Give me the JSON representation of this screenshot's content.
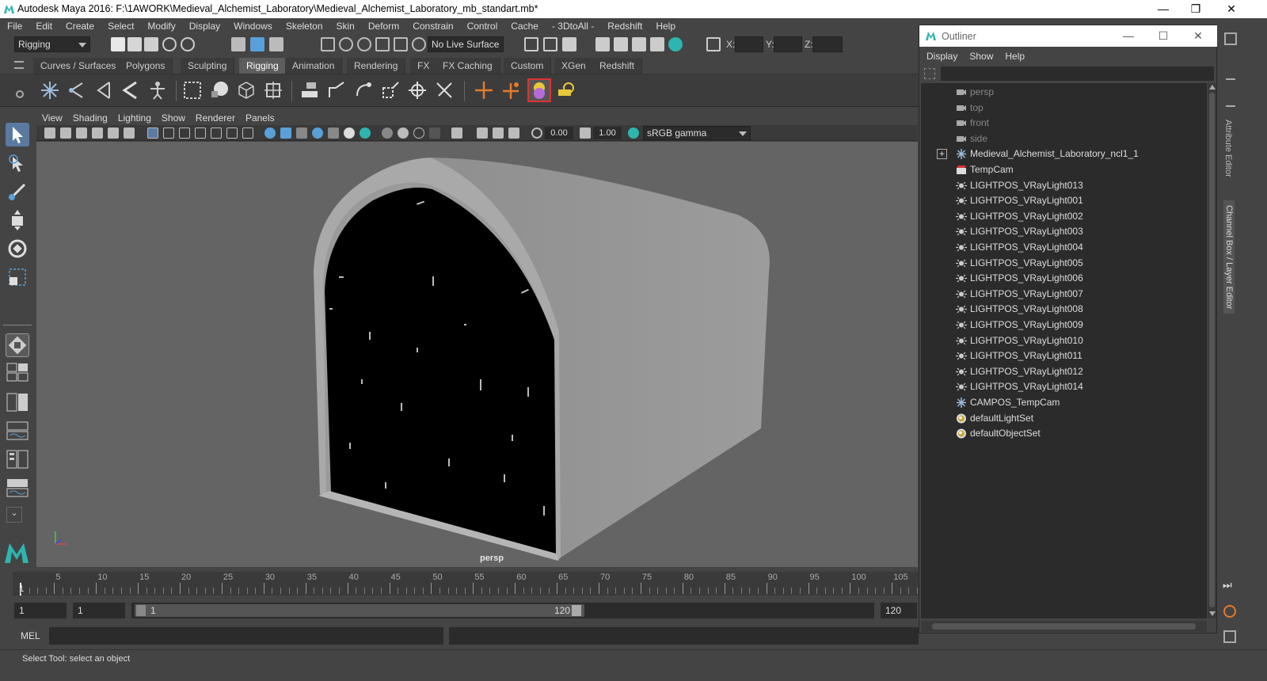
{
  "window": {
    "title": "Autodesk Maya 2016: F:\\1AWORK\\Medieval_Alchemist_Laboratory\\Medieval_Alchemist_Laboratory_mb_standart.mb*",
    "minimize": "—",
    "maximize": "❐",
    "close": "✕"
  },
  "menubar": [
    "File",
    "Edit",
    "Create",
    "Select",
    "Modify",
    "Display",
    "Windows",
    "Skeleton",
    "Skin",
    "Deform",
    "Constrain",
    "Control",
    "Cache",
    "- 3DtoAll -",
    "Redshift",
    "Help"
  ],
  "statusline": {
    "mode": "Rigging",
    "live_surface": "No Live Surface",
    "x_label": "X:",
    "y_label": "Y:",
    "z_label": "Z:"
  },
  "shelf_tabs": [
    {
      "label": "Curves / Surfaces",
      "active": false
    },
    {
      "label": "Polygons",
      "active": false
    },
    {
      "label": "Sculpting",
      "active": false
    },
    {
      "label": "Rigging",
      "active": true
    },
    {
      "label": "Animation",
      "active": false
    },
    {
      "label": "Rendering",
      "active": false
    },
    {
      "label": "FX",
      "active": false
    },
    {
      "label": "FX Caching",
      "active": false
    },
    {
      "label": "Custom",
      "active": false
    },
    {
      "label": "XGen",
      "active": false
    },
    {
      "label": "Redshift",
      "active": false
    }
  ],
  "viewport": {
    "menu": [
      "View",
      "Shading",
      "Lighting",
      "Show",
      "Renderer",
      "Panels"
    ],
    "exposure": "0.00",
    "gamma": "1.00",
    "color_space": "sRGB gamma",
    "camera_label": "persp"
  },
  "timeline": {
    "ticks": [
      "5",
      "10",
      "15",
      "20",
      "25",
      "30",
      "35",
      "40",
      "45",
      "50",
      "55",
      "60",
      "65",
      "70",
      "75",
      "80",
      "85",
      "90",
      "95",
      "100",
      "105"
    ],
    "current_frame": "1"
  },
  "range": {
    "start": "1",
    "playback_start": "1",
    "slider_start": "1",
    "slider_end": "120",
    "end": "120"
  },
  "command": {
    "lang": "MEL"
  },
  "helpline": "Select Tool: select an object",
  "outliner": {
    "title": "Outliner",
    "menu": [
      "Display",
      "Show",
      "Help"
    ],
    "items": [
      {
        "label": "persp",
        "icon": "camera-icon",
        "dim": true
      },
      {
        "label": "top",
        "icon": "camera-icon",
        "dim": true
      },
      {
        "label": "front",
        "icon": "camera-icon",
        "dim": true
      },
      {
        "label": "side",
        "icon": "camera-icon",
        "dim": true
      },
      {
        "label": "Medieval_Alchemist_Laboratory_ncl1_1",
        "icon": "locator-icon",
        "dim": false,
        "expand": true
      },
      {
        "label": "TempCam",
        "icon": "clapper-icon",
        "dim": false
      },
      {
        "label": "LIGHTPOS_VRayLight013",
        "icon": "light-icon",
        "dim": false
      },
      {
        "label": "LIGHTPOS_VRayLight001",
        "icon": "light-icon",
        "dim": false
      },
      {
        "label": "LIGHTPOS_VRayLight002",
        "icon": "light-icon",
        "dim": false
      },
      {
        "label": "LIGHTPOS_VRayLight003",
        "icon": "light-icon",
        "dim": false
      },
      {
        "label": "LIGHTPOS_VRayLight004",
        "icon": "light-icon",
        "dim": false
      },
      {
        "label": "LIGHTPOS_VRayLight005",
        "icon": "light-icon",
        "dim": false
      },
      {
        "label": "LIGHTPOS_VRayLight006",
        "icon": "light-icon",
        "dim": false
      },
      {
        "label": "LIGHTPOS_VRayLight007",
        "icon": "light-icon",
        "dim": false
      },
      {
        "label": "LIGHTPOS_VRayLight008",
        "icon": "light-icon",
        "dim": false
      },
      {
        "label": "LIGHTPOS_VRayLight009",
        "icon": "light-icon",
        "dim": false
      },
      {
        "label": "LIGHTPOS_VRayLight010",
        "icon": "light-icon",
        "dim": false
      },
      {
        "label": "LIGHTPOS_VRayLight011",
        "icon": "light-icon",
        "dim": false
      },
      {
        "label": "LIGHTPOS_VRayLight012",
        "icon": "light-icon",
        "dim": false
      },
      {
        "label": "LIGHTPOS_VRayLight014",
        "icon": "light-icon",
        "dim": false
      },
      {
        "label": "CAMPOS_TempCam",
        "icon": "locator-icon",
        "dim": false
      },
      {
        "label": "defaultLightSet",
        "icon": "set-icon",
        "dim": false
      },
      {
        "label": "defaultObjectSet",
        "icon": "set-icon",
        "dim": false
      }
    ]
  },
  "side_tabs": [
    "Attribute Editor",
    "Channel Box / Layer Editor"
  ],
  "colors": {
    "accent": "#5aa0d8",
    "maya_teal": "#2fb5b0",
    "panel": "#444444",
    "field": "#2b2b2b",
    "viewport_bg": "#646464"
  }
}
